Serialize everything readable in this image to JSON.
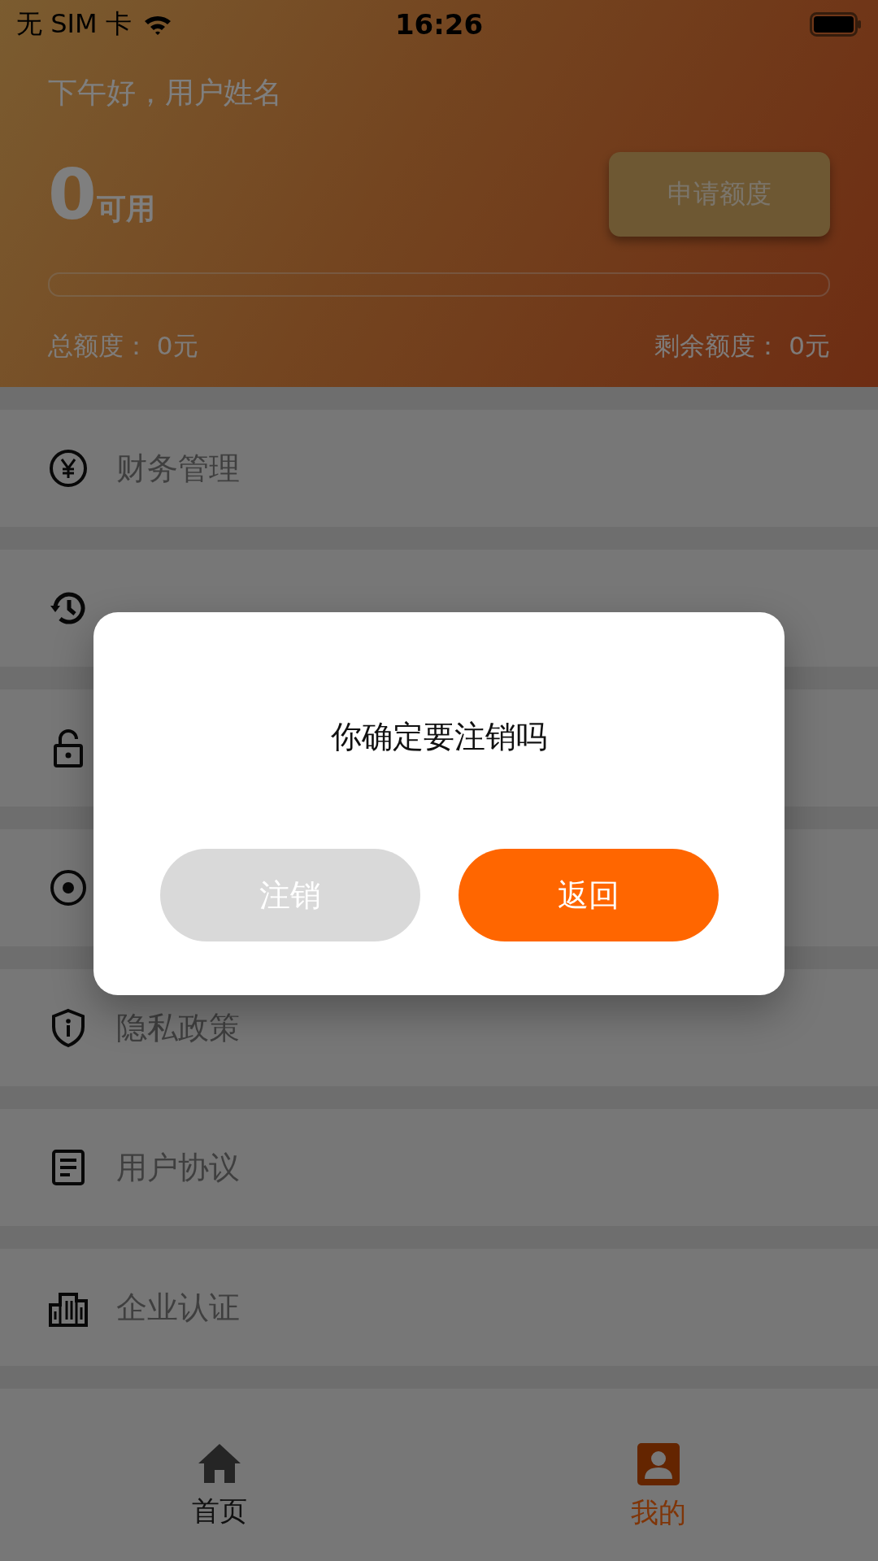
{
  "status_bar": {
    "carrier": "无 SIM 卡",
    "time": "16:26"
  },
  "header": {
    "greeting": "下午好，用户姓名",
    "amount": "0",
    "amount_unit": "可用",
    "apply_button": "申请额度",
    "progress": {
      "level": 0
    },
    "total": "总额度：  0元",
    "remaining": "剩余额度：  0元"
  },
  "menu": [
    {
      "label": "财务管理"
    },
    {
      "label": "隐私政策"
    },
    {
      "label": "用户协议"
    },
    {
      "label": "企业认证"
    }
  ],
  "tabs": [
    {
      "label": "首页",
      "selected": false
    },
    {
      "label": "我的",
      "selected": true
    }
  ],
  "dialog": {
    "message": "你确定要注销吗",
    "buttons": [
      {
        "label": "注销",
        "kind": "secondary"
      },
      {
        "label": "返回",
        "kind": "primary"
      }
    ]
  }
}
